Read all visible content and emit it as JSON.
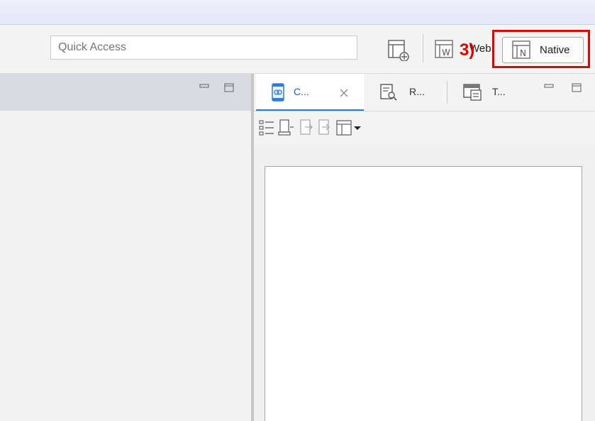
{
  "toolbar": {
    "quick_access_placeholder": "Quick Access",
    "web_label": "Web",
    "native_label": "Native",
    "step_label": "3)"
  },
  "tabs": [
    {
      "label": "C...",
      "active": true
    },
    {
      "label": "R...",
      "active": false
    },
    {
      "label": "T...",
      "active": false
    }
  ],
  "colors": {
    "highlight": "#e60000",
    "active_tab_underline": "#2a7ed8",
    "left_header": "#dadbe0"
  }
}
